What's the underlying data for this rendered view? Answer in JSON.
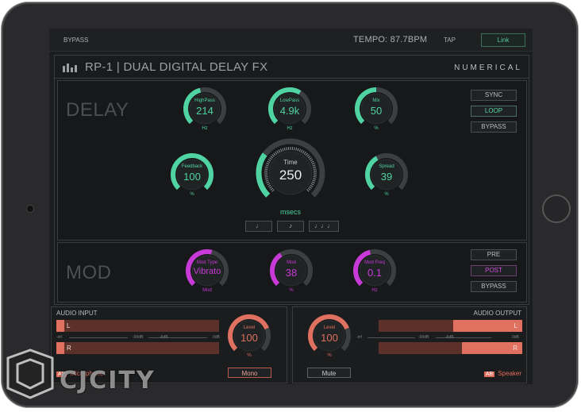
{
  "topbar": {
    "bypass": "BYPASS",
    "tempo": "TEMPO: 87.7BPM",
    "tap": "TAP",
    "link": "Link"
  },
  "plugin": {
    "title": "RP-1 | DUAL DIGITAL DELAY FX",
    "brand": "NUMERICAL"
  },
  "colors": {
    "accent_green": "#4fd3a3",
    "accent_purple": "#c83ad8",
    "accent_red": "#e0705f"
  },
  "delay": {
    "label": "DELAY",
    "knobs": {
      "highpass": {
        "name": "HighPass",
        "value": "214",
        "unit": "Hz",
        "level": 0.45
      },
      "lowpass": {
        "name": "LowPass",
        "value": "4.9k",
        "unit": "Hz",
        "level": 0.62
      },
      "mix": {
        "name": "Mix",
        "value": "50",
        "unit": "%",
        "level": 0.5
      },
      "feedback": {
        "name": "Feedback",
        "value": "100",
        "unit": "%",
        "level": 1.0
      },
      "time": {
        "name": "Time",
        "value": "250",
        "unit": "msecs",
        "level": 0.3
      },
      "spread": {
        "name": "Spread",
        "value": "39",
        "unit": "%",
        "level": 0.39
      }
    },
    "buttons": {
      "sync": "SYNC",
      "loop": "LOOP",
      "bypass": "BYPASS"
    },
    "note_buttons": [
      "♩",
      "♪",
      "♩♩♩"
    ]
  },
  "mod": {
    "label": "MOD",
    "knobs": {
      "modtype": {
        "name": "Mod Type",
        "value": "Vibrato",
        "unit": "Mod",
        "level": 0.55
      },
      "mod": {
        "name": "Mod",
        "value": "38",
        "unit": "%",
        "level": 0.38
      },
      "modfreq": {
        "name": "Mod Freq",
        "value": "0.1",
        "unit": "Hz",
        "level": 0.45
      }
    },
    "buttons": {
      "pre": "PRE",
      "post": "POST",
      "bypass": "BYPASS"
    }
  },
  "audio_input": {
    "title": "AUDIO INPUT",
    "left": {
      "label": "L",
      "level": 0.05
    },
    "right": {
      "label": "R",
      "level": 0.05
    },
    "scale": [
      "-inf",
      "-90dB",
      "-6dB",
      "0dB"
    ],
    "knob": {
      "name": "Level",
      "value": "100",
      "unit": "%",
      "level": 0.75
    },
    "mono": "Mono",
    "source_tag": "AB",
    "source": "Microphone"
  },
  "audio_output": {
    "title": "AUDIO OUTPUT",
    "left": {
      "label": "L",
      "level": 0.48
    },
    "right": {
      "label": "R",
      "level": 0.42
    },
    "scale": [
      "-inf",
      "-90dB",
      "-6dB",
      "0dB"
    ],
    "knob": {
      "name": "Level",
      "value": "100",
      "unit": "%",
      "level": 0.75
    },
    "mute": "Mute",
    "dest_tag": "AB",
    "dest": "Speaker"
  },
  "watermark": {
    "text": "CJCITY"
  }
}
